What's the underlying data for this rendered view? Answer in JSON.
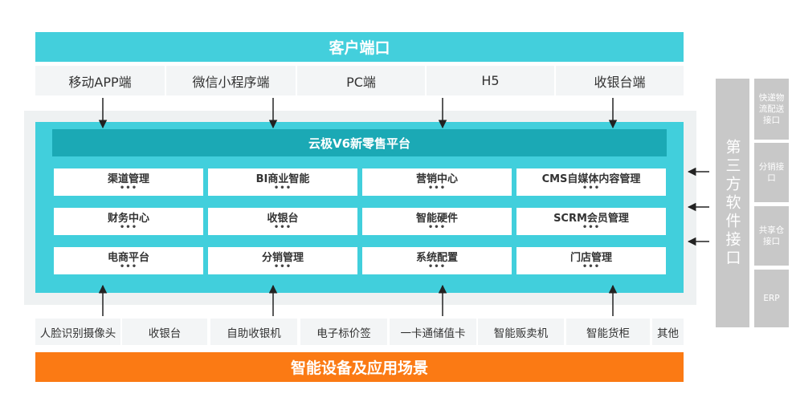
{
  "top_bar": {
    "title": "客户端口"
  },
  "clients": [
    "移动APP端",
    "微信小程序端",
    "PC端",
    "H5",
    "收银台端"
  ],
  "platform": {
    "title": "云极V6新零售平台",
    "modules": [
      [
        "渠道管理",
        "BI商业智能",
        "营销中心",
        "CMS自媒体内容管理"
      ],
      [
        "财务中心",
        "收银台",
        "智能硬件",
        "SCRM会员管理"
      ],
      [
        "电商平台",
        "分销管理",
        "系统配置",
        "门店管理"
      ]
    ],
    "more": "•••"
  },
  "devices": [
    "人脸识别摄像头",
    "收银台",
    "自助收银机",
    "电子标价签",
    "一卡通储值卡",
    "智能贩卖机",
    "智能货柜",
    "其他"
  ],
  "bottom_bar": {
    "title": "智能设备及应用场景"
  },
  "third_party": {
    "title": "第三方软件接口",
    "items": [
      "快递物流配送接口",
      "分销接口",
      "共享仓接口",
      "ERP"
    ]
  },
  "colors": {
    "teal": "#43cfdc",
    "teal_dark": "#1ba9b5",
    "orange": "#fb7a14",
    "gray": "#c8c8c8"
  }
}
